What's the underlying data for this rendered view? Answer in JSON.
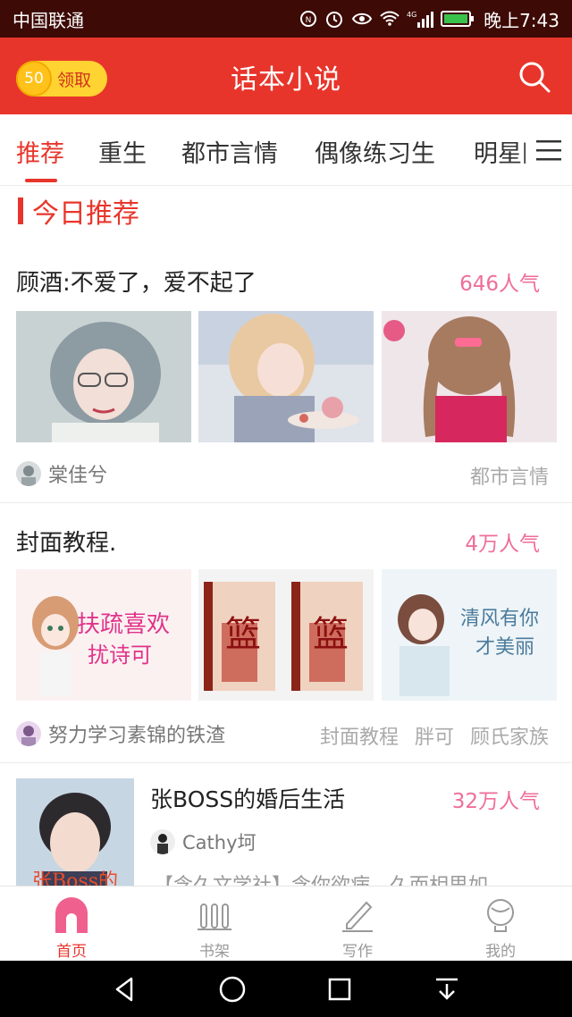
{
  "status_bar": {
    "carrier": "中国联通",
    "network": "4G",
    "time": "晚上7:43"
  },
  "header": {
    "coin_value": "50",
    "coin_label": "领取",
    "title": "话本小说"
  },
  "tabs": [
    {
      "label": "推荐",
      "active": true
    },
    {
      "label": "重生",
      "active": false
    },
    {
      "label": "都市言情",
      "active": false
    },
    {
      "label": "偶像练习生",
      "active": false
    },
    {
      "label": "明星同人",
      "active": false
    }
  ],
  "section": {
    "title": "今日推荐"
  },
  "stories": [
    {
      "title": "顾酒:不爱了，爱不起了",
      "popularity": "646人气",
      "author": "棠佳兮",
      "tags": [
        "都市言情"
      ]
    },
    {
      "title": "封面教程.",
      "popularity": "4万人气",
      "author": "努力学习素锦的铁渣",
      "tags": [
        "封面教程",
        "胖可",
        "顾氏家族"
      ]
    }
  ],
  "featured": {
    "title": "张BOSS的婚后生活",
    "popularity": "32万人气",
    "author": "Cathy坷",
    "description": "【含久文学社】含你欲病，久而相思如",
    "cover_text": "张Boss的"
  },
  "cover_art": {
    "cover_2a_text": "扶疏喜欢",
    "cover_2a_text2": "扰诗可",
    "cover_2b_text": "篮",
    "cover_2c_text": "清风有你",
    "cover_2c_text2": "才美丽"
  },
  "bottom_nav": [
    {
      "label": "首页",
      "icon": "home-icon",
      "active": true
    },
    {
      "label": "书架",
      "icon": "bookshelf-icon",
      "active": false
    },
    {
      "label": "写作",
      "icon": "pen-icon",
      "active": false
    },
    {
      "label": "我的",
      "icon": "profile-icon",
      "active": false
    }
  ],
  "colors": {
    "brand": "#e8352b",
    "popularity": "#ef6e99",
    "status_bar": "#3d0a06"
  }
}
